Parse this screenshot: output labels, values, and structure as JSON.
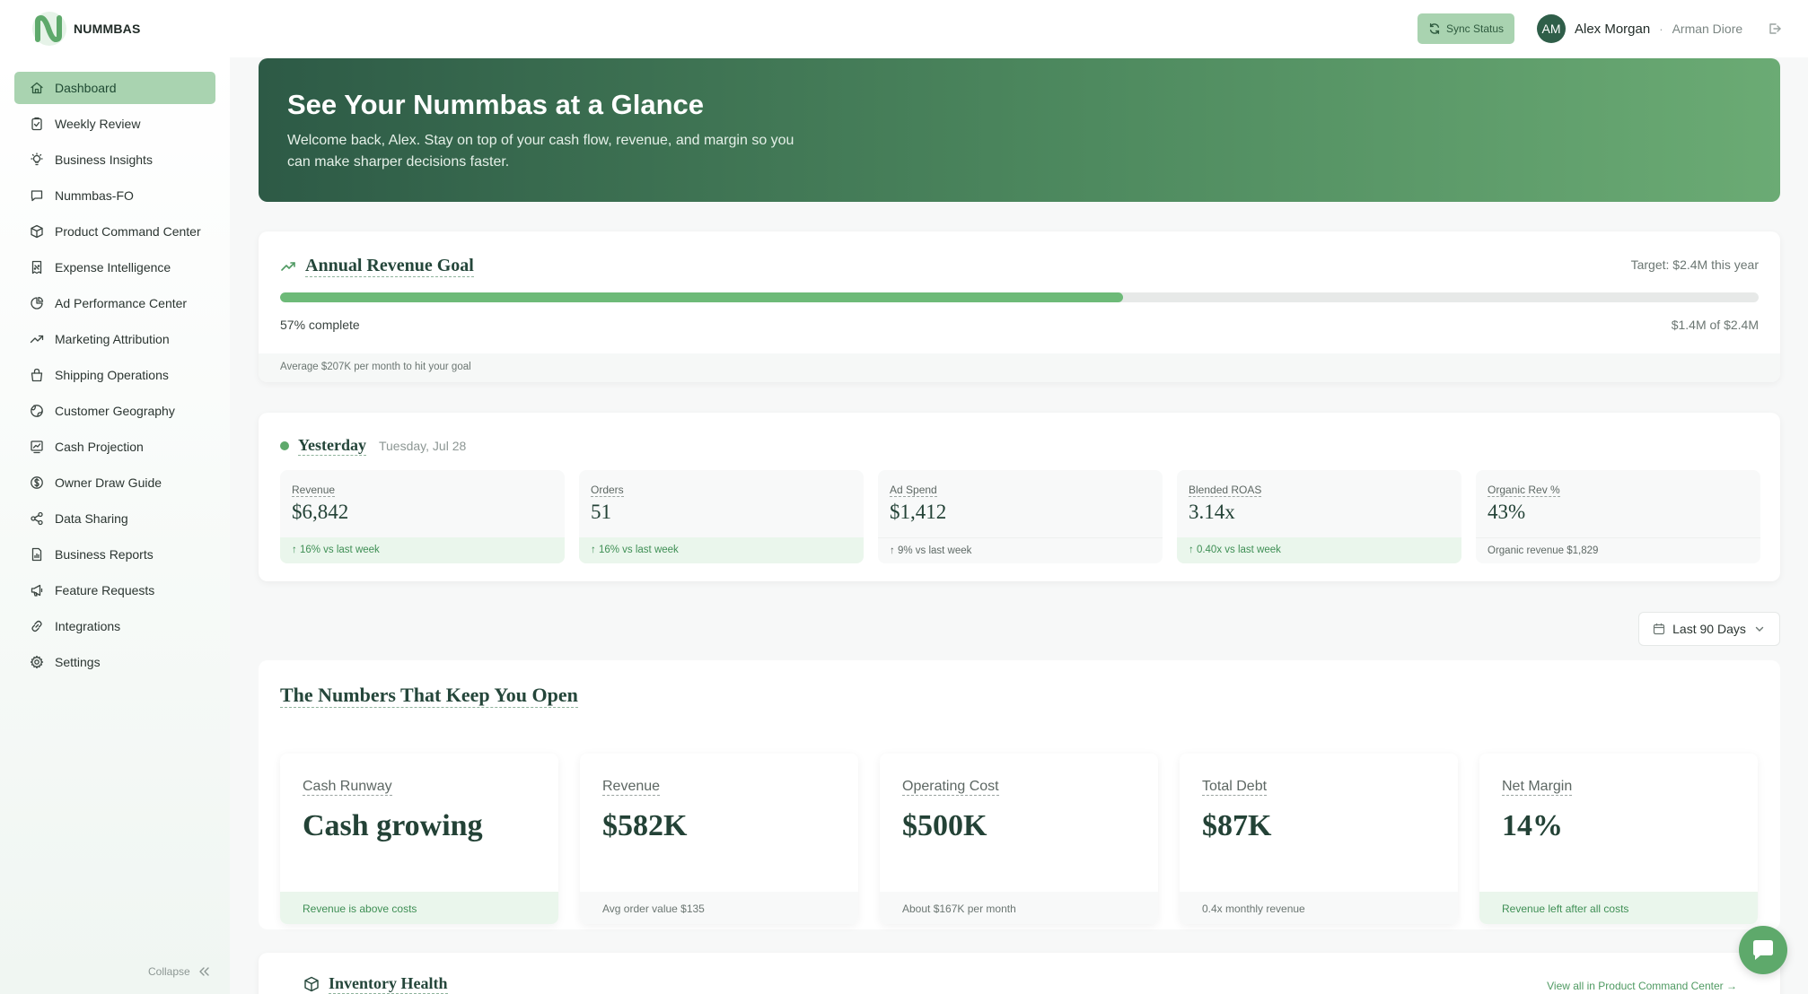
{
  "brand": {
    "name": "NUMMBAS",
    "color": "#5ea96b"
  },
  "topbar": {
    "sync_label": "Sync Status",
    "user_initials": "AM",
    "user_name": "Alex Morgan",
    "separator": "·",
    "org_name": "Arman Diore"
  },
  "sidebar": {
    "items": [
      {
        "label": "Dashboard",
        "icon": "home-icon"
      },
      {
        "label": "Weekly Review",
        "icon": "clipboard-icon"
      },
      {
        "label": "Business Insights",
        "icon": "lightbulb-icon"
      },
      {
        "label": "Nummbas-FO",
        "icon": "chat-icon"
      },
      {
        "label": "Product Command Center",
        "icon": "box-icon"
      },
      {
        "label": "Expense Intelligence",
        "icon": "receipt-icon"
      },
      {
        "label": "Ad Performance Center",
        "icon": "pie-icon"
      },
      {
        "label": "Marketing Attribution",
        "icon": "trend-icon"
      },
      {
        "label": "Shipping Operations",
        "icon": "bag-icon"
      },
      {
        "label": "Customer Geography",
        "icon": "globe-icon"
      },
      {
        "label": "Cash Projection",
        "icon": "chart-icon"
      },
      {
        "label": "Owner Draw Guide",
        "icon": "dollar-icon"
      },
      {
        "label": "Data Sharing",
        "icon": "share-icon"
      },
      {
        "label": "Business Reports",
        "icon": "report-icon"
      },
      {
        "label": "Feature Requests",
        "icon": "megaphone-icon"
      },
      {
        "label": "Integrations",
        "icon": "link-icon"
      },
      {
        "label": "Settings",
        "icon": "gear-icon"
      }
    ],
    "active_index": 0,
    "collapse_label": "Collapse"
  },
  "hero": {
    "title": "See Your Nummbas at a Glance",
    "subtitle": "Welcome back, Alex. Stay on top of your cash flow, revenue, and margin so you can make sharper decisions faster."
  },
  "goal": {
    "title": "Annual Revenue Goal",
    "target": "Target: $2.4M this year",
    "progress_fraction": 0.57,
    "percent_text": "57% complete",
    "amount_text": "$1.4M of $2.4M",
    "footer": "Average $207K per month to hit your goal"
  },
  "yesterday": {
    "title": "Yesterday",
    "date": "Tuesday, Jul 28",
    "kpis": [
      {
        "label": "Revenue",
        "value": "$6,842",
        "foot": "↑ 16% vs last week",
        "positive": true
      },
      {
        "label": "Orders",
        "value": "51",
        "foot": "↑ 16% vs last week",
        "positive": true
      },
      {
        "label": "Ad Spend",
        "value": "$1,412",
        "foot": "↑ 9% vs last week",
        "positive": false
      },
      {
        "label": "Blended ROAS",
        "value": "3.14x",
        "foot": "↑ 0.40x vs last week",
        "positive": true
      },
      {
        "label": "Organic Rev %",
        "value": "43%",
        "foot": "Organic revenue $1,829",
        "positive": false
      }
    ]
  },
  "date_range": {
    "label": "Last 90 Days"
  },
  "numbers": {
    "title": "The Numbers That Keep You Open",
    "metrics": [
      {
        "label": "Cash Runway",
        "value": "Cash growing",
        "foot": "Revenue is above costs",
        "positive": true
      },
      {
        "label": "Revenue",
        "value": "$582K",
        "foot": "Avg order value $135",
        "positive": false
      },
      {
        "label": "Operating Cost",
        "value": "$500K",
        "foot": "About $167K per month",
        "positive": false
      },
      {
        "label": "Total Debt",
        "value": "$87K",
        "foot": "0.4x monthly revenue",
        "positive": false
      },
      {
        "label": "Net Margin",
        "value": "14%",
        "foot": "Revenue left after all costs",
        "positive": true
      }
    ]
  },
  "inventory": {
    "title": "Inventory Health",
    "link": "View all in Product Command Center →"
  }
}
